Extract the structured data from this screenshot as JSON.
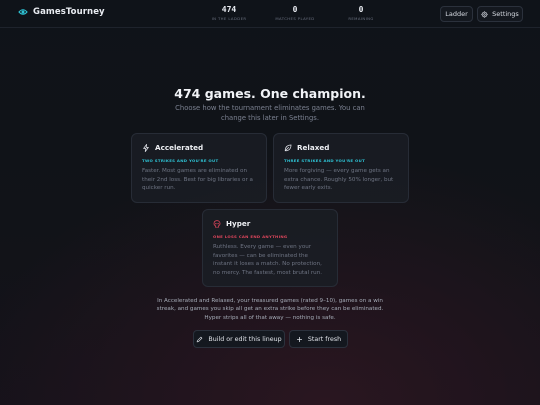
{
  "header": {
    "brand": "GamesTourney",
    "stats": [
      {
        "value": "474",
        "label": "in the ladder"
      },
      {
        "value": "0",
        "label": "matches played"
      },
      {
        "value": "0",
        "label": "remaining"
      }
    ],
    "ladder_label": "Ladder",
    "settings_label": "Settings"
  },
  "hero": {
    "title": "474 games. One champion.",
    "subtitle": "Choose how the tournament eliminates games. You can change this later in Settings."
  },
  "modes": {
    "accelerated": {
      "title": "Accelerated",
      "tag": "TWO STRIKES AND YOU'RE OUT",
      "description": "Faster. Most games are eliminated on their 2nd loss. Best for big libraries or a quicker run."
    },
    "relaxed": {
      "title": "Relaxed",
      "tag": "THREE STRIKES AND YOU'RE OUT",
      "description": "More forgiving — every game gets an extra chance. Roughly 50% longer, but fewer early exits."
    },
    "hyper": {
      "title": "Hyper",
      "tag": "ONE LOSS CAN END ANYTHING",
      "description": "Ruthless. Every game — even your favorites — can be eliminated the instant it loses a match. No protection, no mercy. The fastest, most brutal run."
    }
  },
  "footnote": "In Accelerated and Relaxed, your treasured games (rated 9–10), games on a win streak, and games you skip all get an extra strike before they can be eliminated. Hyper strips all of that away — nothing is safe.",
  "actions": {
    "build_label": "Build or edit this lineup",
    "fresh_label": "Start fresh"
  },
  "colors": {
    "accent_cyan": "#2ec4d6",
    "accent_red": "#e0465c"
  },
  "icons": {
    "brand": "eye-logo-icon",
    "settings": "gear-icon",
    "accelerated": "lightning-icon",
    "relaxed": "leaf-icon",
    "hyper": "skull-icon",
    "build": "pencil-icon",
    "fresh": "plus-icon"
  }
}
